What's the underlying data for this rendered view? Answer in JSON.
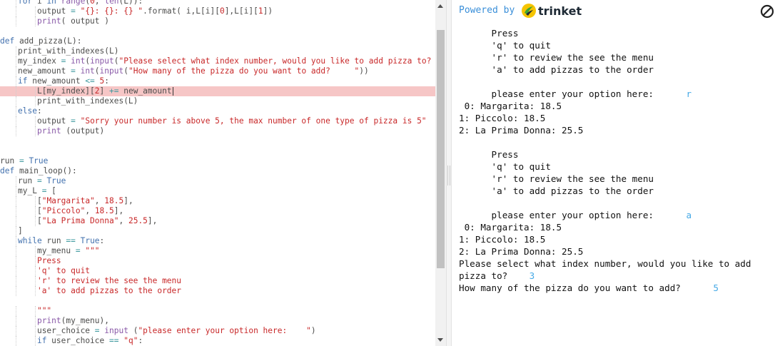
{
  "editor": {
    "lines": [
      {
        "indent": 1,
        "tokens": [
          [
            "k",
            "for "
          ],
          [
            "d",
            "i "
          ],
          [
            "k",
            "in "
          ],
          [
            "f",
            "range"
          ],
          [
            "d",
            "("
          ],
          [
            "n",
            "0"
          ],
          [
            "d",
            ", "
          ],
          [
            "f",
            "len"
          ],
          [
            "d",
            "(L)):"
          ]
        ]
      },
      {
        "indent": 2,
        "tokens": [
          [
            "d",
            "output "
          ],
          [
            "o",
            "= "
          ],
          [
            "s",
            "\"{}: {}: {} \""
          ],
          [
            "d",
            ".format( i,L[i]["
          ],
          [
            "n",
            "0"
          ],
          [
            "d",
            "],L[i]["
          ],
          [
            "n",
            "1"
          ],
          [
            "d",
            "])"
          ]
        ]
      },
      {
        "indent": 2,
        "tokens": [
          [
            "f",
            "print"
          ],
          [
            "d",
            "( output )"
          ]
        ]
      },
      {
        "indent": 0,
        "tokens": []
      },
      {
        "indent": 0,
        "tokens": [
          [
            "k",
            "def "
          ],
          [
            "d",
            "add_pizza(L):"
          ]
        ]
      },
      {
        "indent": 1,
        "tokens": [
          [
            "d",
            "print_with_indexes(L)"
          ]
        ]
      },
      {
        "indent": 1,
        "tokens": [
          [
            "d",
            "my_index "
          ],
          [
            "o",
            "= "
          ],
          [
            "f",
            "int"
          ],
          [
            "d",
            "("
          ],
          [
            "f",
            "input"
          ],
          [
            "d",
            "("
          ],
          [
            "s",
            "\"Please select what index number, would you like to add pizza to?"
          ]
        ]
      },
      {
        "indent": 1,
        "tokens": [
          [
            "d",
            "new_amount "
          ],
          [
            "o",
            "= "
          ],
          [
            "f",
            "int"
          ],
          [
            "d",
            "("
          ],
          [
            "f",
            "input"
          ],
          [
            "d",
            "("
          ],
          [
            "s",
            "\"How many of the pizza do you want to add?     \""
          ],
          [
            "d",
            "))"
          ]
        ]
      },
      {
        "indent": 1,
        "tokens": [
          [
            "k",
            "if "
          ],
          [
            "d",
            "new_amount "
          ],
          [
            "o",
            "<= "
          ],
          [
            "n",
            "5"
          ],
          [
            "d",
            ":"
          ]
        ]
      },
      {
        "indent": 2,
        "tokens": [
          [
            "d",
            "L[my_index]["
          ],
          [
            "n",
            "2"
          ],
          [
            "d",
            "] "
          ],
          [
            "o",
            "+= "
          ],
          [
            "d",
            "new_amount"
          ]
        ],
        "highlight": true,
        "caret": true
      },
      {
        "indent": 2,
        "tokens": [
          [
            "d",
            "print_with_indexes(L)"
          ]
        ]
      },
      {
        "indent": 1,
        "tokens": [
          [
            "k",
            "else"
          ],
          [
            "d",
            ":"
          ]
        ]
      },
      {
        "indent": 2,
        "tokens": [
          [
            "d",
            "output "
          ],
          [
            "o",
            "= "
          ],
          [
            "s",
            "\"Sorry your number is above 5, the max number of one type of pizza is 5\""
          ]
        ]
      },
      {
        "indent": 2,
        "tokens": [
          [
            "f",
            "print "
          ],
          [
            "d",
            "(output)"
          ]
        ]
      },
      {
        "indent": 0,
        "tokens": []
      },
      {
        "indent": 0,
        "tokens": []
      },
      {
        "indent": 0,
        "tokens": [
          [
            "d",
            "run "
          ],
          [
            "o",
            "= "
          ],
          [
            "k",
            "True"
          ]
        ]
      },
      {
        "indent": 0,
        "tokens": [
          [
            "k",
            "def "
          ],
          [
            "d",
            "main_loop():"
          ]
        ]
      },
      {
        "indent": 1,
        "tokens": [
          [
            "d",
            "run "
          ],
          [
            "o",
            "= "
          ],
          [
            "k",
            "True"
          ]
        ]
      },
      {
        "indent": 1,
        "tokens": [
          [
            "d",
            "my_L "
          ],
          [
            "o",
            "= "
          ],
          [
            "d",
            "["
          ]
        ]
      },
      {
        "indent": 2,
        "tokens": [
          [
            "d",
            "["
          ],
          [
            "s",
            "\"Margarita\""
          ],
          [
            "d",
            ", "
          ],
          [
            "n",
            "18.5"
          ],
          [
            "d",
            "],"
          ]
        ]
      },
      {
        "indent": 2,
        "tokens": [
          [
            "d",
            "["
          ],
          [
            "s",
            "\"Piccolo\""
          ],
          [
            "d",
            ", "
          ],
          [
            "n",
            "18.5"
          ],
          [
            "d",
            "],"
          ]
        ]
      },
      {
        "indent": 2,
        "tokens": [
          [
            "d",
            "["
          ],
          [
            "s",
            "\"La Prima Donna\""
          ],
          [
            "d",
            ", "
          ],
          [
            "n",
            "25.5"
          ],
          [
            "d",
            "],"
          ]
        ]
      },
      {
        "indent": 1,
        "tokens": [
          [
            "d",
            "]"
          ]
        ]
      },
      {
        "indent": 1,
        "tokens": [
          [
            "k",
            "while "
          ],
          [
            "d",
            "run "
          ],
          [
            "o",
            "== "
          ],
          [
            "k",
            "True"
          ],
          [
            "d",
            ":"
          ]
        ]
      },
      {
        "indent": 2,
        "tokens": [
          [
            "d",
            "my_menu "
          ],
          [
            "o",
            "= "
          ],
          [
            "s",
            "\"\"\""
          ]
        ]
      },
      {
        "indent": 2,
        "tokens": [
          [
            "s",
            "Press"
          ]
        ]
      },
      {
        "indent": 2,
        "tokens": [
          [
            "s",
            "'q' to quit"
          ]
        ]
      },
      {
        "indent": 2,
        "tokens": [
          [
            "s",
            "'r' to review the see the menu"
          ]
        ]
      },
      {
        "indent": 2,
        "tokens": [
          [
            "s",
            "'a' to add pizzas to the order"
          ]
        ]
      },
      {
        "indent": 0,
        "tokens": []
      },
      {
        "indent": 2,
        "tokens": [
          [
            "s",
            "\"\"\""
          ]
        ]
      },
      {
        "indent": 2,
        "tokens": [
          [
            "f",
            "print"
          ],
          [
            "d",
            "(my_menu),"
          ]
        ]
      },
      {
        "indent": 2,
        "tokens": [
          [
            "d",
            "user_choice "
          ],
          [
            "o",
            "= "
          ],
          [
            "f",
            "input "
          ],
          [
            "d",
            "("
          ],
          [
            "s",
            "\"please enter your option here:    \""
          ],
          [
            "d",
            ")"
          ]
        ]
      },
      {
        "indent": 2,
        "tokens": [
          [
            "k",
            "if "
          ],
          [
            "d",
            "user_choice "
          ],
          [
            "o",
            "== "
          ],
          [
            "s",
            "\"q\""
          ],
          [
            "d",
            ":"
          ]
        ]
      }
    ]
  },
  "output": {
    "powered_by": "Powered by",
    "brand": "trinket",
    "console": [
      {
        "indent": 6,
        "parts": [
          [
            "t",
            "Press"
          ]
        ]
      },
      {
        "indent": 6,
        "parts": [
          [
            "t",
            "'q' to quit"
          ]
        ]
      },
      {
        "indent": 6,
        "parts": [
          [
            "t",
            "'r' to review the see the menu"
          ]
        ]
      },
      {
        "indent": 6,
        "parts": [
          [
            "t",
            "'a' to add pizzas to the order"
          ]
        ]
      },
      {
        "indent": 0,
        "parts": []
      },
      {
        "indent": 6,
        "parts": [
          [
            "t",
            "please enter your option here:      "
          ],
          [
            "i",
            "r"
          ]
        ]
      },
      {
        "indent": 0,
        "parts": [
          [
            "t",
            " 0: Margarita: 18.5"
          ]
        ]
      },
      {
        "indent": 0,
        "parts": [
          [
            "t",
            "1: Piccolo: 18.5"
          ]
        ]
      },
      {
        "indent": 0,
        "parts": [
          [
            "t",
            "2: La Prima Donna: 25.5"
          ]
        ]
      },
      {
        "indent": 0,
        "parts": []
      },
      {
        "indent": 6,
        "parts": [
          [
            "t",
            "Press"
          ]
        ]
      },
      {
        "indent": 6,
        "parts": [
          [
            "t",
            "'q' to quit"
          ]
        ]
      },
      {
        "indent": 6,
        "parts": [
          [
            "t",
            "'r' to review the see the menu"
          ]
        ]
      },
      {
        "indent": 6,
        "parts": [
          [
            "t",
            "'a' to add pizzas to the order"
          ]
        ]
      },
      {
        "indent": 0,
        "parts": []
      },
      {
        "indent": 6,
        "parts": [
          [
            "t",
            "please enter your option here:      "
          ],
          [
            "i",
            "a"
          ]
        ]
      },
      {
        "indent": 0,
        "parts": [
          [
            "t",
            " 0: Margarita: 18.5"
          ]
        ]
      },
      {
        "indent": 0,
        "parts": [
          [
            "t",
            "1: Piccolo: 18.5"
          ]
        ]
      },
      {
        "indent": 0,
        "parts": [
          [
            "t",
            "2: La Prima Donna: 25.5"
          ]
        ]
      },
      {
        "indent": 0,
        "parts": [
          [
            "t",
            "Please select what index number, would you like to add"
          ]
        ]
      },
      {
        "indent": 0,
        "parts": [
          [
            "t",
            "pizza to?    "
          ],
          [
            "i",
            "3"
          ]
        ]
      },
      {
        "indent": 0,
        "parts": [
          [
            "t",
            "How many of the pizza do you want to add?      "
          ],
          [
            "i",
            "5"
          ]
        ]
      }
    ]
  },
  "colors": {
    "string": "#c82829",
    "keyword": "#4271ae",
    "builtin": "#8959a8",
    "highlight": "#f6c6c6",
    "user_input": "#45a9e6",
    "link": "#3a8fd9"
  }
}
